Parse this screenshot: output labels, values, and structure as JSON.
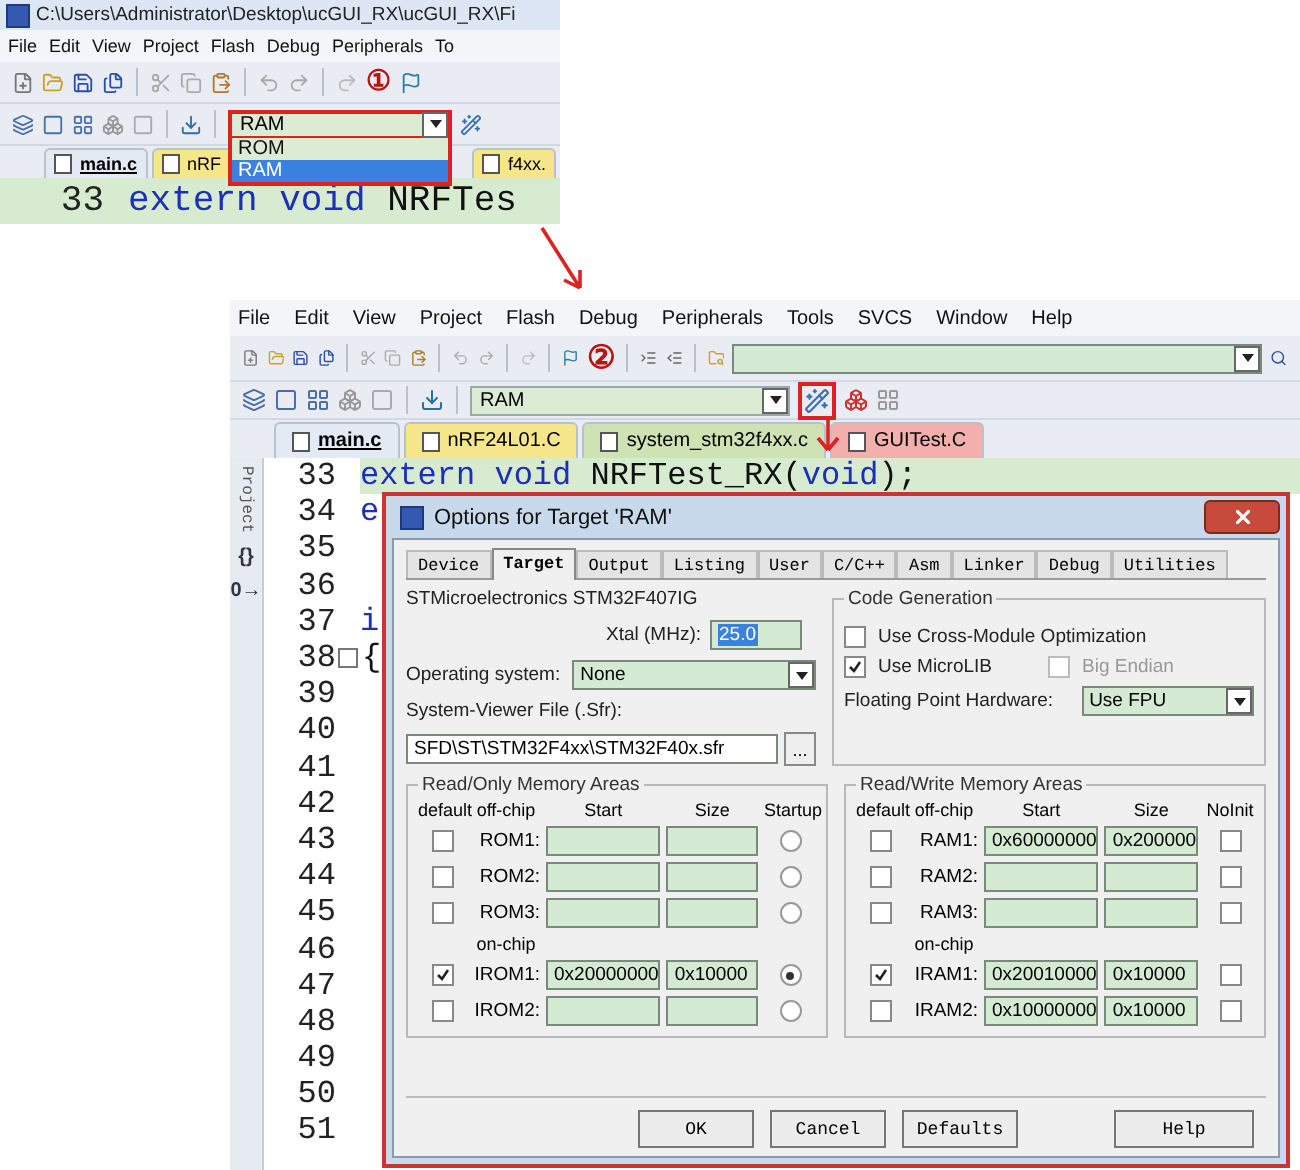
{
  "step1": {
    "title": "C:\\Users\\Administrator\\Desktop\\ucGUI_RX\\ucGUI_RX\\Fi",
    "menu": [
      "File",
      "Edit",
      "View",
      "Project",
      "Flash",
      "Debug",
      "Peripherals",
      "To"
    ],
    "step_mark": "①",
    "target": {
      "value": "RAM",
      "highlighted": true,
      "options": [
        {
          "label": "ROM",
          "selected": false
        },
        {
          "label": "RAM",
          "selected": true
        }
      ]
    },
    "tabs": [
      {
        "label": "main.c",
        "selected": true
      },
      {
        "label": "nRF",
        "selected": false
      },
      {
        "label": "f4xx.",
        "selected": false
      }
    ],
    "code": {
      "number": "33",
      "tokens": [
        {
          "kind": "keyword",
          "text": "extern void "
        },
        {
          "kind": "plain",
          "text": "NRFTes"
        }
      ]
    }
  },
  "step2": {
    "menu": [
      "File",
      "Edit",
      "View",
      "Project",
      "Flash",
      "Debug",
      "Peripherals",
      "Tools",
      "SVCS",
      "Window",
      "Help"
    ],
    "step_mark": "②",
    "target": {
      "value": "RAM"
    },
    "options_highlighted": true,
    "tabs": [
      {
        "label": "main.c",
        "selected": true,
        "color": "#e4eaf4"
      },
      {
        "label": "nRF24L01.C",
        "selected": false,
        "color": "#f6e68a"
      },
      {
        "label": "system_stm32f4xx.c",
        "selected": false,
        "color": "#cfe2b4"
      },
      {
        "label": "GUITest.C",
        "selected": false,
        "color": "#f3aeae"
      }
    ],
    "sidebar": {
      "label": "Project",
      "glyphs": [
        "{}",
        "0→"
      ]
    },
    "lines": [
      {
        "number": "33",
        "tokens": [
          {
            "kind": "keyword",
            "text": "extern void "
          },
          {
            "kind": "plain",
            "text": "NRFTest_RX("
          },
          {
            "kind": "keyword",
            "text": "void"
          },
          {
            "kind": "plain",
            "text": ");"
          }
        ]
      },
      {
        "number": "34",
        "tokens": [
          {
            "kind": "keyword",
            "text": "e"
          }
        ]
      },
      {
        "number": "35"
      },
      {
        "number": "36"
      },
      {
        "number": "37",
        "tokens": [
          {
            "kind": "keyword",
            "text": "i"
          }
        ]
      },
      {
        "number": "38",
        "fold": true,
        "tokens": [
          {
            "kind": "plain",
            "text": "{"
          }
        ]
      },
      {
        "number": "39"
      },
      {
        "number": "40"
      },
      {
        "number": "41"
      },
      {
        "number": "42"
      },
      {
        "number": "43"
      },
      {
        "number": "44"
      },
      {
        "number": "45"
      },
      {
        "number": "46"
      },
      {
        "number": "47"
      },
      {
        "number": "48"
      },
      {
        "number": "49"
      },
      {
        "number": "50"
      },
      {
        "number": "51"
      }
    ],
    "dialog": {
      "title": "Options for Target 'RAM'",
      "tabs": [
        {
          "label": "Device",
          "selected": false
        },
        {
          "label": "Target",
          "selected": true
        },
        {
          "label": "Output",
          "selected": false
        },
        {
          "label": "Listing",
          "selected": false
        },
        {
          "label": "User",
          "selected": false
        },
        {
          "label": "C/C++",
          "selected": false
        },
        {
          "label": "Asm",
          "selected": false
        },
        {
          "label": "Linker",
          "selected": false
        },
        {
          "label": "Debug",
          "selected": false
        },
        {
          "label": "Utilities",
          "selected": false
        }
      ],
      "device": "STMicroelectronics STM32F407IG",
      "xtal": {
        "label": "Xtal (MHz):",
        "value": "25.0"
      },
      "os": {
        "label": "Operating system:",
        "value": "None"
      },
      "sysviewer": {
        "label": "System-Viewer File (.Sfr):",
        "value": "SFD\\ST\\STM32F4xx\\STM32F40x.sfr",
        "browse": "..."
      },
      "code_gen": {
        "title": "Code Generation",
        "options": [
          {
            "label": "Use Cross-Module Optimization",
            "checked": false,
            "disabled": false
          },
          {
            "label": "Use MicroLIB",
            "checked": true,
            "disabled": false
          },
          {
            "label": "Big Endian",
            "checked": false,
            "disabled": true
          }
        ],
        "fpu": {
          "label": "Floating Point Hardware:",
          "value": "Use FPU"
        }
      },
      "memory": [
        {
          "title": "Read/Only Memory Areas",
          "kind": "radio",
          "columns": [
            "default",
            "off-chip",
            "Start",
            "Size",
            "Startup"
          ],
          "off_chip": [
            {
              "label": "ROM1:",
              "default": false,
              "flag": false
            },
            {
              "label": "ROM2:",
              "default": false,
              "flag": false
            },
            {
              "label": "ROM3:",
              "default": false,
              "flag": false
            }
          ],
          "on_chip_label": "on-chip",
          "on_chip": [
            {
              "label": "IROM1:",
              "default": true,
              "start": "0x20000000",
              "size": "0x10000",
              "flag": true
            },
            {
              "label": "IROM2:",
              "default": false,
              "flag": false
            }
          ]
        },
        {
          "title": "Read/Write Memory Areas",
          "kind": "checkbox",
          "columns": [
            "default",
            "off-chip",
            "Start",
            "Size",
            "NoInit"
          ],
          "off_chip": [
            {
              "label": "RAM1:",
              "default": false,
              "start": "0x60000000",
              "size": "0x200000",
              "flag": false
            },
            {
              "label": "RAM2:",
              "default": false,
              "flag": false
            },
            {
              "label": "RAM3:",
              "default": false,
              "flag": false
            }
          ],
          "on_chip_label": "on-chip",
          "on_chip": [
            {
              "label": "IRAM1:",
              "default": true,
              "start": "0x20010000",
              "size": "0x10000",
              "flag": false
            },
            {
              "label": "IRAM2:",
              "default": false,
              "start": "0x10000000",
              "size": "0x10000",
              "flag": false
            }
          ]
        }
      ],
      "buttons": [
        "OK",
        "Cancel",
        "Defaults",
        "Help"
      ]
    }
  }
}
